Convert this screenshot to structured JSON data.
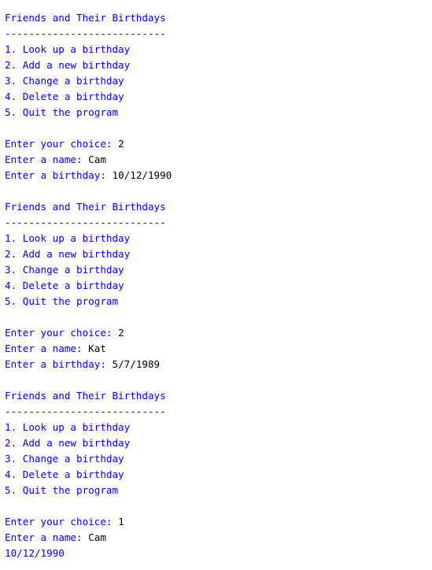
{
  "colors": {
    "program_output": "#0000ff",
    "user_input": "#000000",
    "background": "#ffffff"
  },
  "console": {
    "blocks": [
      {
        "title": "Friends and Their Birthdays",
        "divider": "---------------------------",
        "menu": [
          "1. Look up a birthday",
          "2. Add a new birthday",
          "3. Change a birthday",
          "4. Delete a birthday",
          "5. Quit the program"
        ],
        "choice_prompt": "Enter your choice: ",
        "choice_value": "2",
        "name_prompt": "Enter a name: ",
        "name_value": "Cam",
        "birthday_prompt": "Enter a birthday: ",
        "birthday_value": "10/12/1990"
      },
      {
        "title": "Friends and Their Birthdays",
        "divider": "---------------------------",
        "menu": [
          "1. Look up a birthday",
          "2. Add a new birthday",
          "3. Change a birthday",
          "4. Delete a birthday",
          "5. Quit the program"
        ],
        "choice_prompt": "Enter your choice: ",
        "choice_value": "2",
        "name_prompt": "Enter a name: ",
        "name_value": "Kat",
        "birthday_prompt": "Enter a birthday: ",
        "birthday_value": "5/7/1989"
      },
      {
        "title": "Friends and Their Birthdays",
        "divider": "---------------------------",
        "menu": [
          "1. Look up a birthday",
          "2. Add a new birthday",
          "3. Change a birthday",
          "4. Delete a birthday",
          "5. Quit the program"
        ],
        "choice_prompt": "Enter your choice: ",
        "choice_value": "1",
        "name_prompt": "Enter a name: ",
        "name_value": "Cam",
        "result": "10/12/1990"
      }
    ]
  }
}
